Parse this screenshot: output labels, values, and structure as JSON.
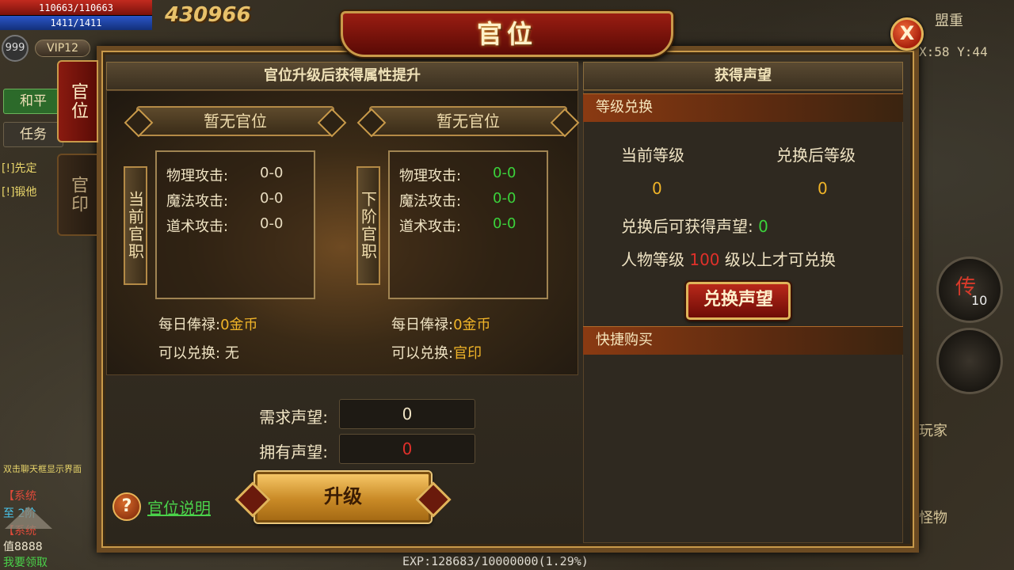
{
  "hud": {
    "hp": "110663/110663",
    "mp": "1411/1411",
    "level": "999",
    "vip": "VIP12",
    "combat_power": "430966",
    "mode_peace": "和平",
    "tab_task": "任务",
    "quest_1": "[!]先定",
    "quest_2": "[!]锻他",
    "area_title": "盟重",
    "coords": "X:58 Y:44",
    "skill_chuan": "传",
    "skill_chuan_count": "10",
    "label_player": "玩家",
    "label_monster": "怪物",
    "chat_1": "双击聊天框显示界面",
    "chat_2": "【系统",
    "chat_3": "至 2阶",
    "chat_4": "【系统",
    "chat_5": "值8888",
    "chat_6": "我要领取",
    "exp": "EXP:128683/10000000(1.29%)"
  },
  "dialog": {
    "title": "官位",
    "close_label": "X",
    "tabs": [
      {
        "label": "官位"
      },
      {
        "label": "官印"
      }
    ],
    "left": {
      "header": "官位升级后获得属性提升",
      "current": {
        "tier_name": "暂无官位",
        "side_label": "当前官职",
        "stats": [
          {
            "label": "物理攻击:",
            "value": "0-0"
          },
          {
            "label": "魔法攻击:",
            "value": "0-0"
          },
          {
            "label": "道术攻击:",
            "value": "0-0"
          }
        ],
        "salary_label": "每日俸禄:",
        "salary_value": "0金币",
        "exchange_label": "可以兑换:",
        "exchange_value": "无"
      },
      "next": {
        "tier_name": "暂无官位",
        "side_label": "下阶官职",
        "stats": [
          {
            "label": "物理攻击:",
            "value": "0-0"
          },
          {
            "label": "魔法攻击:",
            "value": "0-0"
          },
          {
            "label": "道术攻击:",
            "value": "0-0"
          }
        ],
        "salary_label": "每日俸禄:",
        "salary_value": "0金币",
        "exchange_label": "可以兑换:",
        "exchange_value": "官印"
      },
      "required_label": "需求声望:",
      "required_value": "0",
      "owned_label": "拥有声望:",
      "owned_value": "0",
      "upgrade_label": "升级",
      "help_label": "官位说明"
    },
    "right": {
      "header": "获得声望",
      "section_level_exchange": "等级兑换",
      "current_level_label": "当前等级",
      "after_level_label": "兑换后等级",
      "current_level_value": "0",
      "after_level_value": "0",
      "gain_label": "兑换后可获得声望:",
      "gain_value": "0",
      "req_prefix": "人物等级",
      "req_level": "100",
      "req_suffix": "级以上才可兑换",
      "exchange_button": "兑换声望",
      "section_quick_buy": "快捷购买"
    }
  }
}
